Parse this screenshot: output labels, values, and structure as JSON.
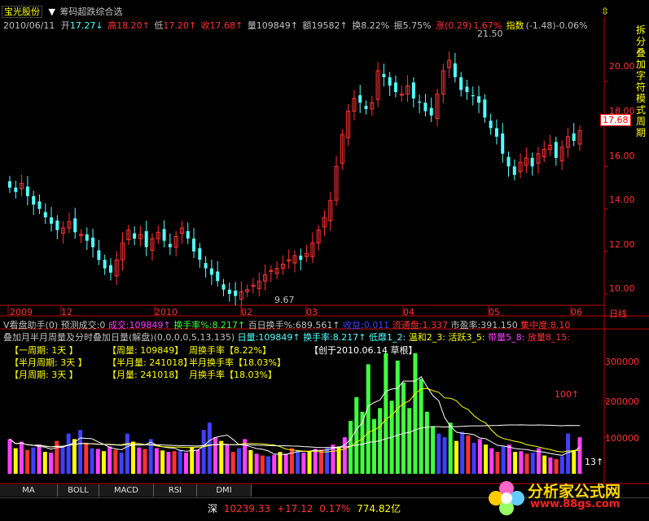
{
  "header": {
    "stock_name": "宝光股份",
    "menu_icon": "menu-icon",
    "formula_name": "筹码超跌综合选",
    "window_button": "⇳",
    "date": "2010/06/11",
    "open_label": "开",
    "open_value": "17.27",
    "open_arrow": "↓",
    "high_label": "高",
    "high_value": "18.20",
    "high_arrow": "↑",
    "low_label": "低",
    "low_value": "17.20",
    "low_arrow": "↑",
    "close_label": "收",
    "close_value": "17.68",
    "close_arrow": "↑",
    "volume_label": "量",
    "volume_value": "109849",
    "volume_arrow": "↑",
    "amount_label": "额",
    "amount_value": "19582",
    "amount_arrow": "↑",
    "turnover_label": "换",
    "turnover_value": "8.22%",
    "amplitude_label": "振",
    "amplitude_value": "5.75%",
    "change_label": "涨",
    "change_value": "(0.29)",
    "change_pct": "1.67%",
    "index_label": "指数",
    "index_value": "(-1.48)",
    "index_pct": "-0.06%"
  },
  "right_panel_text": "拆分叠加字符模式周期",
  "info_line1": {
    "title": "V看盘助手(0)",
    "forecast": "预测成交:0",
    "vol_label": "成交:",
    "vol_value": "109849↑",
    "turn_label": "换手率%:",
    "turn_value": "8.217↑",
    "hundred_label": "百日换手%:",
    "hundred_value": "689.561↑",
    "profit_label": "收益:",
    "profit_value": "0.011",
    "float_label": "流通盘:",
    "float_value": "1.337",
    "pe_label": "市盈率:",
    "pe_value": "391.150",
    "conc_label": "集中度:",
    "conc_value": "8.10"
  },
  "info_line2": {
    "title": "叠加月半月周量及分时叠加日量(解盘)(0,0,0,0,5,13,135)",
    "day_label": "日量:",
    "day_value": "109849↑",
    "turn_label": "换手率:",
    "turn_value": "8.217↑",
    "low_label": "低靡1_2:",
    "warm_label": "温和2_3:",
    "active_label": "活跃3_5:",
    "band_label": "带量5_8:",
    "heavy_label": "放量8_15:"
  },
  "info_boxes": {
    "row1": [
      "【一周期: 1天 】",
      "【周量: 109849】",
      "周换手率【8.22%】"
    ],
    "row2": [
      "【半月周期: 3天 】",
      "【半月量: 241018】",
      "半月换手率【18.03%】"
    ],
    "row3": [
      "【月周期: 3天 】",
      "【月量: 241018】",
      "月换手率【18.03%】"
    ],
    "created": "【创于2010.06.14 草根】"
  },
  "price_axis_labels": [
    "20.00",
    "18.00",
    "16.00",
    "14.00",
    "12.00",
    "10.00"
  ],
  "price_current": "17.68",
  "price_max_label": "21.50",
  "price_min_label": "9.67",
  "vol_axis_labels": [
    "300000",
    "200000",
    "100000"
  ],
  "vol_marker_label": "100↑",
  "vol_marker_small": "13↑",
  "date_axis_labels": [
    "2009",
    "12",
    "2010",
    "02",
    "03",
    "04",
    "05",
    "06"
  ],
  "date_axis_right": "日线",
  "bottom_tabs": [
    "MA",
    "BOLL",
    "MACD",
    "RSI",
    "DMI"
  ],
  "status_bar": {
    "market": "深",
    "value": "10239.33",
    "change": "+17.12",
    "pct": "0.17%",
    "amount": "774.82亿"
  },
  "logo": {
    "name": "分析家公式网",
    "url": "www.88gs.com"
  },
  "colors": {
    "up": "#ff3232",
    "down": "#54ffff",
    "axis": "#c00000",
    "yellow": "#ffff00",
    "magenta": "#ff40ff",
    "green": "#40ff40",
    "blue": "#4040ff"
  },
  "chart_data": [
    {
      "type": "candlestick",
      "x": [
        "2009-11",
        "2009-12",
        "2010-01",
        "2010-02",
        "2010-03",
        "2010-04",
        "2010-05",
        "2010-06"
      ],
      "ylim": [
        9.5,
        22.3
      ],
      "max": 21.5,
      "min": 9.67,
      "last_close": 17.68,
      "closes": [
        15.0,
        14.8,
        15.2,
        14.6,
        14.2,
        14.0,
        13.6,
        13.3,
        13.0,
        13.1,
        13.4,
        12.9,
        12.8,
        12.5,
        12.2,
        11.6,
        11.2,
        11.0,
        11.6,
        12.4,
        13.0,
        12.6,
        12.8,
        12.2,
        12.6,
        12.9,
        12.5,
        12.2,
        12.7,
        13.1,
        12.6,
        12.0,
        11.6,
        11.2,
        10.9,
        10.6,
        10.2,
        10.0,
        9.9,
        10.1,
        10.2,
        10.4,
        10.6,
        10.9,
        11.1,
        11.2,
        11.4,
        11.6,
        11.8,
        11.6,
        11.9,
        12.4,
        13.0,
        13.6,
        14.4,
        16.0,
        17.5,
        18.6,
        19.2,
        19.0,
        18.7,
        19.0,
        20.5,
        20.2,
        19.8,
        19.5,
        19.4,
        19.8,
        19.2,
        19.0,
        18.6,
        18.4,
        19.4,
        20.5,
        21.0,
        20.2,
        19.6,
        19.5,
        19.3,
        19.0,
        18.3,
        17.8,
        17.4,
        16.6,
        16.0,
        15.6,
        16.2,
        16.4,
        16.0,
        16.6,
        16.8,
        17.0,
        16.4,
        16.9,
        17.4,
        17.2,
        17.68
      ]
    },
    {
      "type": "bar",
      "title": "volume",
      "ylim": [
        0,
        350000
      ],
      "values": [
        95000,
        70000,
        88000,
        65000,
        72000,
        80000,
        60000,
        58000,
        90000,
        75000,
        110000,
        95000,
        120000,
        85000,
        70000,
        68000,
        62000,
        75000,
        66000,
        58000,
        110000,
        88000,
        72000,
        68000,
        95000,
        70000,
        64000,
        60000,
        62000,
        65000,
        58000,
        72000,
        66000,
        120000,
        140000,
        100000,
        90000,
        80000,
        60000,
        70000,
        95000,
        65000,
        55000,
        50000,
        48000,
        52000,
        60000,
        55000,
        70000,
        65000,
        58000,
        62000,
        68000,
        66000,
        72000,
        80000,
        75000,
        100000,
        145000,
        210000,
        170000,
        300000,
        150000,
        180000,
        330000,
        200000,
        310000,
        250000,
        180000,
        330000,
        260000,
        170000,
        130000,
        110000,
        100000,
        140000,
        90000,
        115000,
        105000,
        85000,
        95000,
        80000,
        70000,
        60000,
        75000,
        80000,
        60000,
        62000,
        55000,
        58000,
        70000,
        50000,
        45000,
        40000,
        48000,
        110000,
        65000,
        100000
      ]
    }
  ]
}
